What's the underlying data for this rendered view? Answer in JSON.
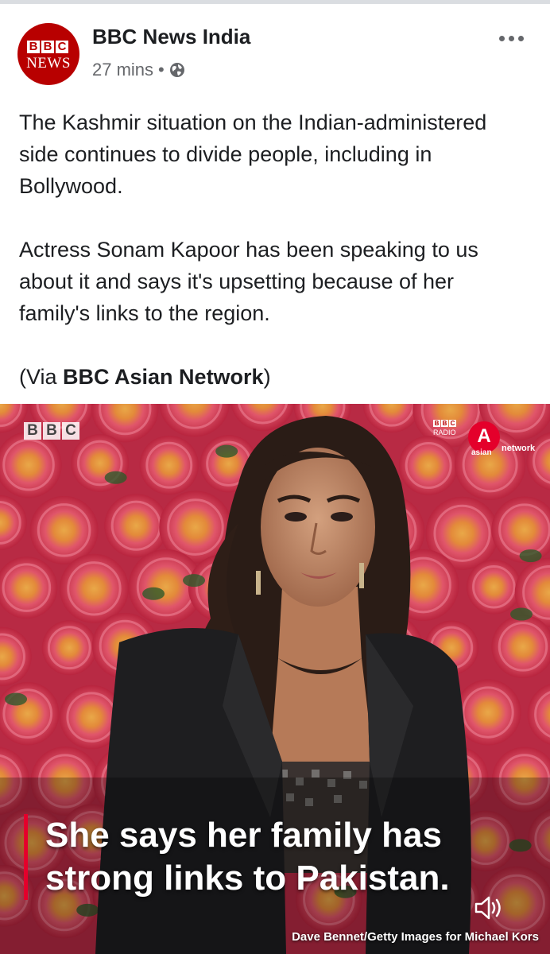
{
  "post": {
    "page_name": "BBC News India",
    "timestamp": "27 mins",
    "separator": "•",
    "privacy_icon": "globe-icon",
    "more_icon": "more-options-icon",
    "avatar": {
      "blocks": [
        "B",
        "B",
        "C"
      ],
      "word": "NEWS",
      "color": "#b80000"
    },
    "paragraphs": [
      "The Kashmir situation on the Indian-administered side continues to divide people, including in Bollywood.",
      "Actress Sonam Kapoor has been speaking to us about it and says it's upsetting because of her family's links to the region."
    ],
    "via": {
      "prefix": "(Via ",
      "link": "BBC Asian Network",
      "suffix": ")"
    }
  },
  "media": {
    "logo_blocks": [
      "B",
      "B",
      "C"
    ],
    "radio_logo": {
      "blocks": [
        "B",
        "B",
        "C"
      ],
      "word": "RADIO",
      "letter": "A",
      "asian": "asian",
      "network": "network"
    },
    "caption_line1": "She says her family has",
    "caption_line2": "strong links to Pakistan.",
    "sound_icon": "speaker-icon",
    "credit": "Dave Bennet/Getty Images for Michael Kors",
    "accent_color": "#e4002b"
  }
}
